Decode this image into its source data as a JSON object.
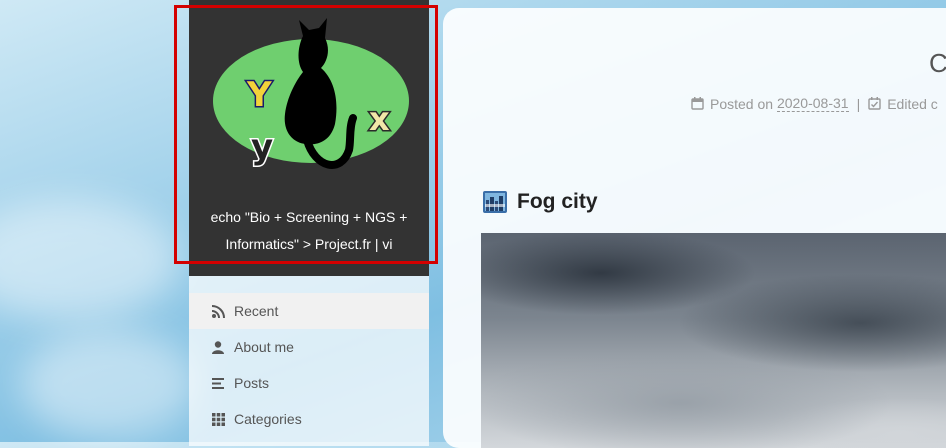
{
  "brand": {
    "subtitle_line1": "echo \"Bio + Screening + NGS +",
    "subtitle_line2": "Informatics\" > Project.fr | vi",
    "logo_letters": [
      "Y",
      "y",
      "x"
    ],
    "colors": {
      "background": "#333333",
      "ellipse": "#6fcf6f",
      "highlight": "#d40000"
    }
  },
  "menu": {
    "items": [
      {
        "label": "Recent",
        "icon": "rss-icon"
      },
      {
        "label": "About me",
        "icon": "user-icon"
      },
      {
        "label": "Posts",
        "icon": "list-icon"
      },
      {
        "label": "Categories",
        "icon": "grid-icon"
      }
    ]
  },
  "post": {
    "title_fragment": "C",
    "posted_label": "Posted on",
    "posted_date": "2020-08-31",
    "separator": "|",
    "edited_label": "Edited c",
    "section_title": "Fog city"
  }
}
